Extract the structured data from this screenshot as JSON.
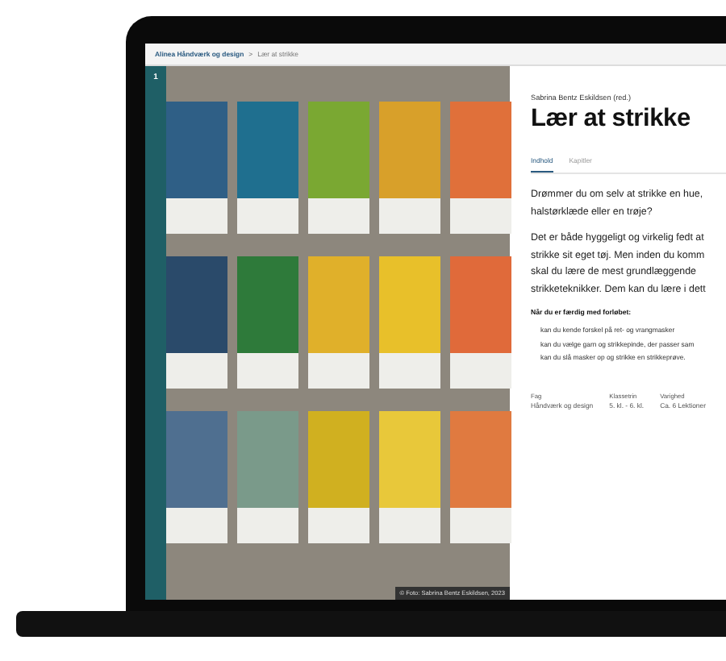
{
  "breadcrumb": {
    "root": "Alinea Håndværk og design",
    "separator": ">",
    "current": "Lær at strikke"
  },
  "sidebar": {
    "page_number": "1"
  },
  "photo": {
    "credit": "© Foto: Sabrina Bentz Eskildsen, 2023"
  },
  "article": {
    "author": "Sabrina Bentz Eskildsen (red.)",
    "title": "Lær at strikke",
    "tabs": [
      {
        "label": "Indhold",
        "selected": true
      },
      {
        "label": "Kapitler",
        "selected": false
      }
    ],
    "paragraphs": [
      [
        "Drømmer du om selv at strikke en hue,",
        "halstørklæde eller en trøje?"
      ],
      [
        "Det er både hyggeligt og virkelig fedt at",
        "strikke sit eget tøj. Men inden du komm",
        "skal du lære de mest grundlæggende",
        "strikketeknikker. Dem kan du lære i dett"
      ]
    ],
    "goals_heading": "Når du er færdig med forløbet:",
    "goals": [
      "kan du kende forskel på ret- og vrangmasker",
      "kan du vælge garn og strikkepinde, der passer sam",
      "kan du slå masker op og strikke en strikkeprøve."
    ],
    "meta": [
      {
        "label": "Fag",
        "value": "Håndværk og design"
      },
      {
        "label": "Klassetrin",
        "value": "5. kl. - 6. kl."
      },
      {
        "label": "Varighed",
        "value": "Ca. 6 Lektioner"
      }
    ]
  }
}
